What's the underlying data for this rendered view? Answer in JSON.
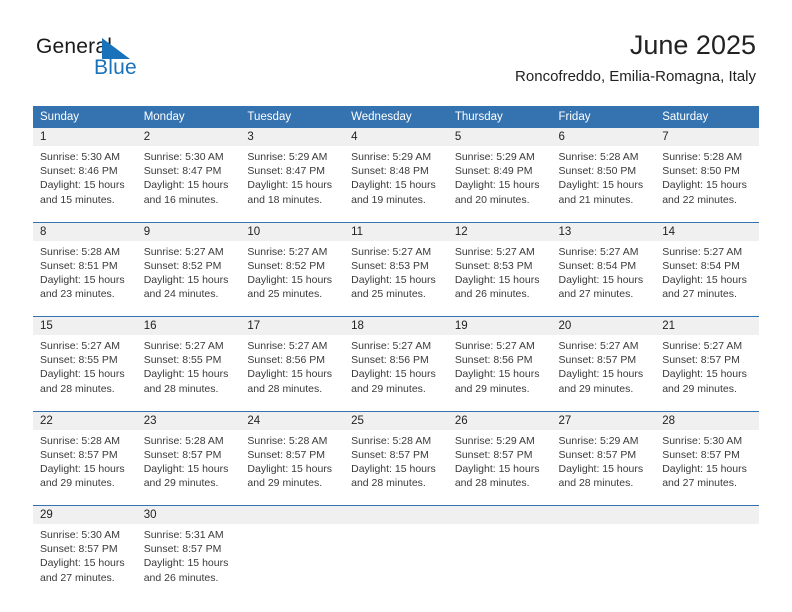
{
  "brand": {
    "name_part1": "General",
    "name_part2": "Blue",
    "mark_name": "triangle-logo-mark",
    "color_primary": "#1a72ba",
    "color_text": "#1a1a1a"
  },
  "header": {
    "title": "June 2025",
    "subtitle": "Roncofreddo, Emilia-Romagna, Italy"
  },
  "theme": {
    "header_background": "#3572b0",
    "header_text": "#ffffff",
    "daynum_band": "#f0f0f0",
    "cell_text": "#3a3a3a",
    "grid_line": "#3572b0"
  },
  "calendar": {
    "weekday_headers": [
      "Sunday",
      "Monday",
      "Tuesday",
      "Wednesday",
      "Thursday",
      "Friday",
      "Saturday"
    ],
    "weeks": [
      [
        {
          "day": "1",
          "sunrise": "Sunrise: 5:30 AM",
          "sunset": "Sunset: 8:46 PM",
          "daylight": "Daylight: 15 hours and 15 minutes."
        },
        {
          "day": "2",
          "sunrise": "Sunrise: 5:30 AM",
          "sunset": "Sunset: 8:47 PM",
          "daylight": "Daylight: 15 hours and 16 minutes."
        },
        {
          "day": "3",
          "sunrise": "Sunrise: 5:29 AM",
          "sunset": "Sunset: 8:47 PM",
          "daylight": "Daylight: 15 hours and 18 minutes."
        },
        {
          "day": "4",
          "sunrise": "Sunrise: 5:29 AM",
          "sunset": "Sunset: 8:48 PM",
          "daylight": "Daylight: 15 hours and 19 minutes."
        },
        {
          "day": "5",
          "sunrise": "Sunrise: 5:29 AM",
          "sunset": "Sunset: 8:49 PM",
          "daylight": "Daylight: 15 hours and 20 minutes."
        },
        {
          "day": "6",
          "sunrise": "Sunrise: 5:28 AM",
          "sunset": "Sunset: 8:50 PM",
          "daylight": "Daylight: 15 hours and 21 minutes."
        },
        {
          "day": "7",
          "sunrise": "Sunrise: 5:28 AM",
          "sunset": "Sunset: 8:50 PM",
          "daylight": "Daylight: 15 hours and 22 minutes."
        }
      ],
      [
        {
          "day": "8",
          "sunrise": "Sunrise: 5:28 AM",
          "sunset": "Sunset: 8:51 PM",
          "daylight": "Daylight: 15 hours and 23 minutes."
        },
        {
          "day": "9",
          "sunrise": "Sunrise: 5:27 AM",
          "sunset": "Sunset: 8:52 PM",
          "daylight": "Daylight: 15 hours and 24 minutes."
        },
        {
          "day": "10",
          "sunrise": "Sunrise: 5:27 AM",
          "sunset": "Sunset: 8:52 PM",
          "daylight": "Daylight: 15 hours and 25 minutes."
        },
        {
          "day": "11",
          "sunrise": "Sunrise: 5:27 AM",
          "sunset": "Sunset: 8:53 PM",
          "daylight": "Daylight: 15 hours and 25 minutes."
        },
        {
          "day": "12",
          "sunrise": "Sunrise: 5:27 AM",
          "sunset": "Sunset: 8:53 PM",
          "daylight": "Daylight: 15 hours and 26 minutes."
        },
        {
          "day": "13",
          "sunrise": "Sunrise: 5:27 AM",
          "sunset": "Sunset: 8:54 PM",
          "daylight": "Daylight: 15 hours and 27 minutes."
        },
        {
          "day": "14",
          "sunrise": "Sunrise: 5:27 AM",
          "sunset": "Sunset: 8:54 PM",
          "daylight": "Daylight: 15 hours and 27 minutes."
        }
      ],
      [
        {
          "day": "15",
          "sunrise": "Sunrise: 5:27 AM",
          "sunset": "Sunset: 8:55 PM",
          "daylight": "Daylight: 15 hours and 28 minutes."
        },
        {
          "day": "16",
          "sunrise": "Sunrise: 5:27 AM",
          "sunset": "Sunset: 8:55 PM",
          "daylight": "Daylight: 15 hours and 28 minutes."
        },
        {
          "day": "17",
          "sunrise": "Sunrise: 5:27 AM",
          "sunset": "Sunset: 8:56 PM",
          "daylight": "Daylight: 15 hours and 28 minutes."
        },
        {
          "day": "18",
          "sunrise": "Sunrise: 5:27 AM",
          "sunset": "Sunset: 8:56 PM",
          "daylight": "Daylight: 15 hours and 29 minutes."
        },
        {
          "day": "19",
          "sunrise": "Sunrise: 5:27 AM",
          "sunset": "Sunset: 8:56 PM",
          "daylight": "Daylight: 15 hours and 29 minutes."
        },
        {
          "day": "20",
          "sunrise": "Sunrise: 5:27 AM",
          "sunset": "Sunset: 8:57 PM",
          "daylight": "Daylight: 15 hours and 29 minutes."
        },
        {
          "day": "21",
          "sunrise": "Sunrise: 5:27 AM",
          "sunset": "Sunset: 8:57 PM",
          "daylight": "Daylight: 15 hours and 29 minutes."
        }
      ],
      [
        {
          "day": "22",
          "sunrise": "Sunrise: 5:28 AM",
          "sunset": "Sunset: 8:57 PM",
          "daylight": "Daylight: 15 hours and 29 minutes."
        },
        {
          "day": "23",
          "sunrise": "Sunrise: 5:28 AM",
          "sunset": "Sunset: 8:57 PM",
          "daylight": "Daylight: 15 hours and 29 minutes."
        },
        {
          "day": "24",
          "sunrise": "Sunrise: 5:28 AM",
          "sunset": "Sunset: 8:57 PM",
          "daylight": "Daylight: 15 hours and 29 minutes."
        },
        {
          "day": "25",
          "sunrise": "Sunrise: 5:28 AM",
          "sunset": "Sunset: 8:57 PM",
          "daylight": "Daylight: 15 hours and 28 minutes."
        },
        {
          "day": "26",
          "sunrise": "Sunrise: 5:29 AM",
          "sunset": "Sunset: 8:57 PM",
          "daylight": "Daylight: 15 hours and 28 minutes."
        },
        {
          "day": "27",
          "sunrise": "Sunrise: 5:29 AM",
          "sunset": "Sunset: 8:57 PM",
          "daylight": "Daylight: 15 hours and 28 minutes."
        },
        {
          "day": "28",
          "sunrise": "Sunrise: 5:30 AM",
          "sunset": "Sunset: 8:57 PM",
          "daylight": "Daylight: 15 hours and 27 minutes."
        }
      ],
      [
        {
          "day": "29",
          "sunrise": "Sunrise: 5:30 AM",
          "sunset": "Sunset: 8:57 PM",
          "daylight": "Daylight: 15 hours and 27 minutes."
        },
        {
          "day": "30",
          "sunrise": "Sunrise: 5:31 AM",
          "sunset": "Sunset: 8:57 PM",
          "daylight": "Daylight: 15 hours and 26 minutes."
        },
        {
          "day": "",
          "sunrise": "",
          "sunset": "",
          "daylight": ""
        },
        {
          "day": "",
          "sunrise": "",
          "sunset": "",
          "daylight": ""
        },
        {
          "day": "",
          "sunrise": "",
          "sunset": "",
          "daylight": ""
        },
        {
          "day": "",
          "sunrise": "",
          "sunset": "",
          "daylight": ""
        },
        {
          "day": "",
          "sunrise": "",
          "sunset": "",
          "daylight": ""
        }
      ]
    ]
  }
}
